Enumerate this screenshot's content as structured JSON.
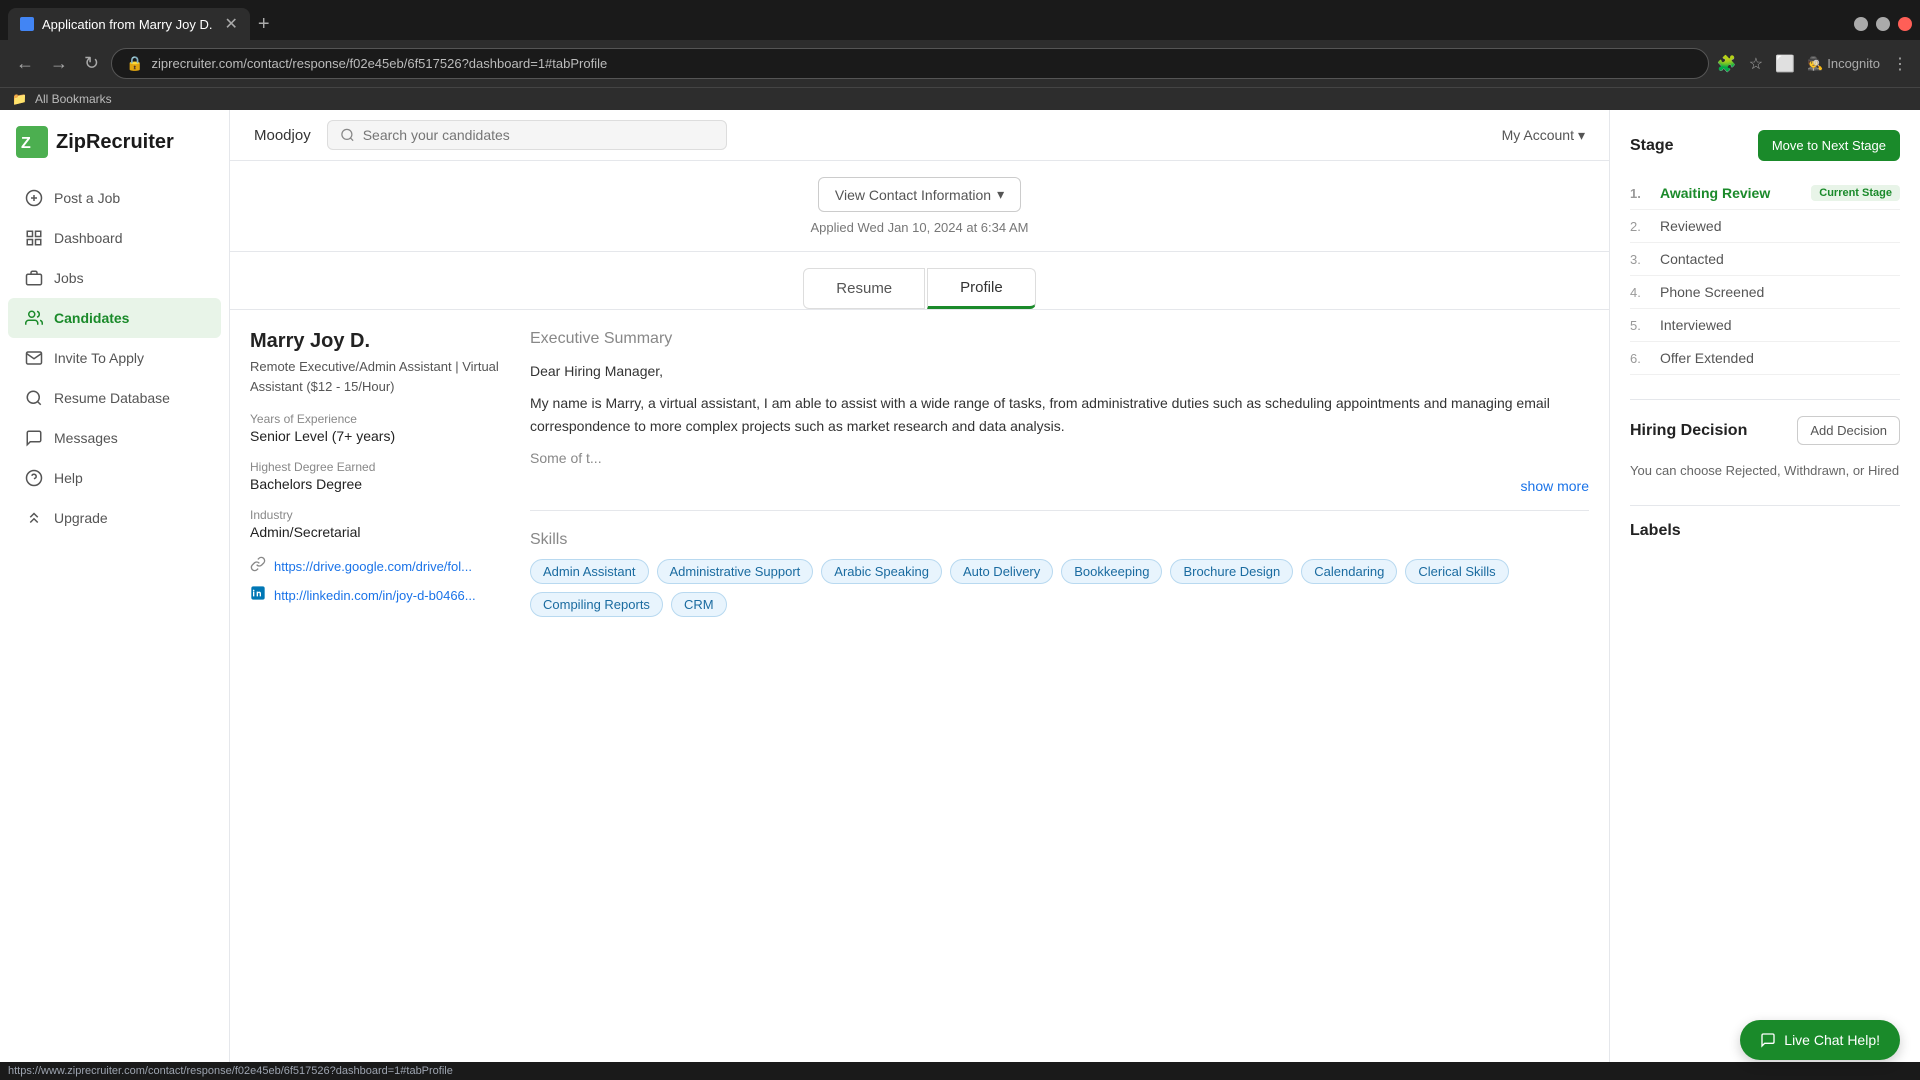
{
  "browser": {
    "tab_title": "Application from Marry Joy D.",
    "url": "ziprecruiter.com/contact/response/f02e45eb/6f517526?dashboard=1#tabProfile",
    "status_url": "https://www.ziprecruiter.com/contact/response/f02e45eb/6f517526?dashboard=1#tabProfile",
    "incognito_label": "Incognito",
    "bookmarks_label": "All Bookmarks"
  },
  "header": {
    "company_name": "Moodjoy",
    "search_placeholder": "Search your candidates",
    "my_account_label": "My Account"
  },
  "sidebar": {
    "logo_text": "ZipRecruiter",
    "items": [
      {
        "id": "post-a-job",
        "label": "Post a Job",
        "icon": "+"
      },
      {
        "id": "dashboard",
        "label": "Dashboard",
        "icon": "⊞"
      },
      {
        "id": "jobs",
        "label": "Jobs",
        "icon": "💼"
      },
      {
        "id": "candidates",
        "label": "Candidates",
        "icon": "👥",
        "active": true
      },
      {
        "id": "invite-to-apply",
        "label": "Invite To Apply",
        "icon": "✉"
      },
      {
        "id": "resume-database",
        "label": "Resume Database",
        "icon": "🔍"
      },
      {
        "id": "messages",
        "label": "Messages",
        "icon": "💬"
      },
      {
        "id": "help",
        "label": "Help",
        "icon": "?"
      },
      {
        "id": "upgrade",
        "label": "Upgrade",
        "icon": "⬆"
      }
    ]
  },
  "candidate": {
    "view_contact_btn": "View Contact Information",
    "applied_date": "Applied Wed Jan 10, 2024 at 6:34 AM",
    "tabs": [
      {
        "id": "resume",
        "label": "Resume"
      },
      {
        "id": "profile",
        "label": "Profile",
        "active": true
      }
    ],
    "name": "Marry Joy D.",
    "title": "Remote Executive/Admin Assistant | Virtual Assistant ($12 - 15/Hour)",
    "experience_label": "Years of Experience",
    "experience_value": "Senior Level (7+ years)",
    "degree_label": "Highest Degree Earned",
    "degree_value": "Bachelors Degree",
    "industry_label": "Industry",
    "industry_value": "Admin/Secretarial",
    "links": [
      {
        "type": "drive",
        "url": "https://drive.google.com/drive/fol..."
      },
      {
        "type": "linkedin",
        "url": "http://linkedin.com/in/joy-d-b0466..."
      }
    ],
    "executive_summary_title": "Executive Summary",
    "executive_summary_greeting": "Dear Hiring Manager,",
    "executive_summary_body": "My name is Marry, a virtual assistant, I am able to assist with a wide range of tasks, from administrative duties such as scheduling appointments and managing email correspondence to more complex projects such as market research and data analysis.",
    "summary_truncated": "Some of t...",
    "show_more": "show more",
    "skills_title": "Skills",
    "skills": [
      "Admin Assistant",
      "Administrative Support",
      "Arabic Speaking",
      "Auto Delivery",
      "Bookkeeping",
      "Brochure Design",
      "Calendaring",
      "Clerical Skills",
      "Compiling Reports",
      "CRM"
    ]
  },
  "stage_panel": {
    "title": "Stage",
    "move_next_label": "Move to Next Stage",
    "stages": [
      {
        "num": "1.",
        "label": "Awaiting Review",
        "current": true,
        "current_badge": "Current Stage"
      },
      {
        "num": "2.",
        "label": "Reviewed",
        "current": false
      },
      {
        "num": "3.",
        "label": "Contacted",
        "current": false
      },
      {
        "num": "4.",
        "label": "Phone Screened",
        "current": false
      },
      {
        "num": "5.",
        "label": "Interviewed",
        "current": false
      },
      {
        "num": "6.",
        "label": "Offer Extended",
        "current": false
      }
    ]
  },
  "hiring_decision": {
    "title": "Hiring Decision",
    "add_decision_label": "Add Decision",
    "description": "You can choose Rejected, Withdrawn, or Hired"
  },
  "labels": {
    "title": "Labels"
  },
  "live_chat": {
    "label": "Live Chat Help!"
  }
}
